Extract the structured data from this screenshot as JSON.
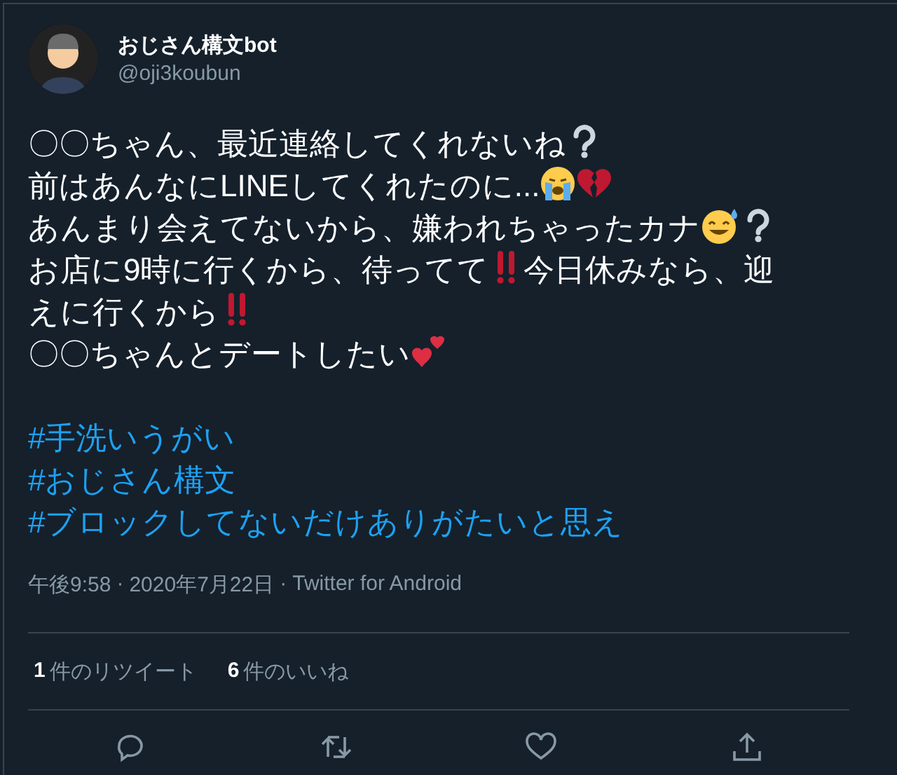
{
  "author": {
    "name": "おじさん構文bot",
    "handle": "@oji3koubun"
  },
  "body": [
    [
      {
        "kind": "text",
        "text": "〇〇ちゃん、最近連絡してくれないね"
      },
      {
        "kind": "question"
      }
    ],
    [
      {
        "kind": "text",
        "text": "前はあんなにLINEしてくれたのに..."
      },
      {
        "kind": "crying"
      },
      {
        "kind": "broken-heart"
      }
    ],
    [
      {
        "kind": "text",
        "text": "あんまり会えてないから、嫌われちゃったカナ"
      },
      {
        "kind": "sweat-smile"
      },
      {
        "kind": "question"
      }
    ],
    [
      {
        "kind": "text",
        "text": "お店に9時に行くから、待ってて"
      },
      {
        "kind": "double-exclamation"
      },
      {
        "kind": "text",
        "text": "今日休みなら、迎"
      }
    ],
    [
      {
        "kind": "text",
        "text": "えに行くから"
      },
      {
        "kind": "double-exclamation"
      }
    ],
    [
      {
        "kind": "text",
        "text": "〇〇ちゃんとデートしたい"
      },
      {
        "kind": "two-hearts"
      }
    ]
  ],
  "hashtags": [
    "#手洗いうがい",
    "#おじさん構文",
    "#ブロックしてないだけありがたいと思え"
  ],
  "meta": {
    "time": "午後9:58",
    "separator": "·",
    "date": "2020年7月22日",
    "source": "Twitter for Android"
  },
  "stats": [
    {
      "count": "1",
      "label": "件のリツイート"
    },
    {
      "count": "6",
      "label": "件のいいね"
    }
  ],
  "actions": [
    {
      "kind": "reply"
    },
    {
      "kind": "retweet"
    },
    {
      "kind": "like"
    },
    {
      "kind": "share"
    }
  ]
}
